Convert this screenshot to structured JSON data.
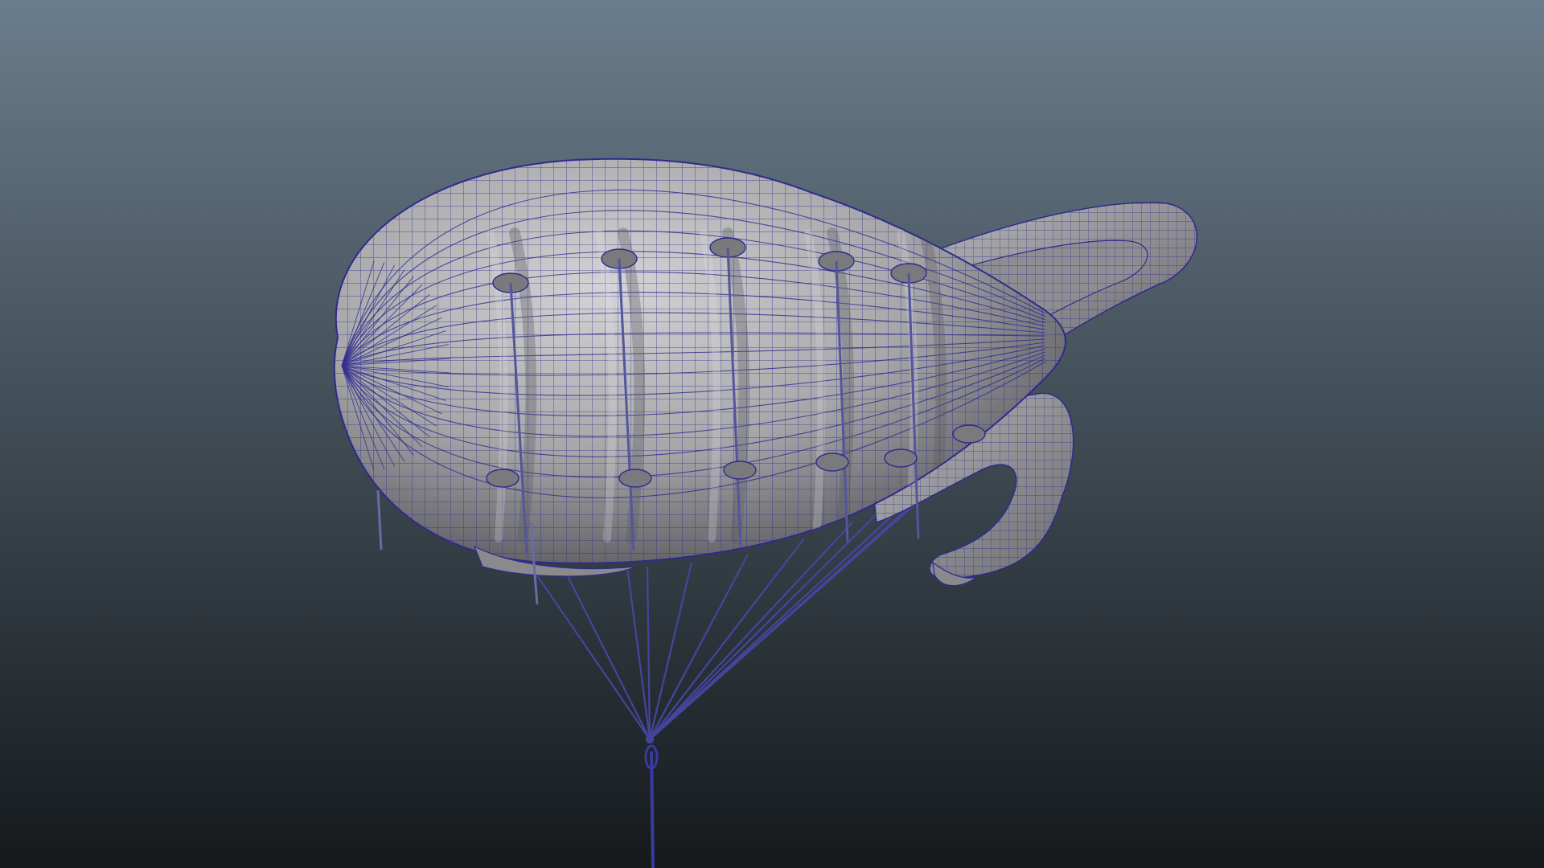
{
  "viewport": {
    "background_top": "#6a7d8c",
    "background_bottom": "#15191c"
  },
  "model": {
    "shaded_color": "#a4a4a6",
    "wireframe_color": "#2f2a8e",
    "highlight_color": "#d2d2d4",
    "shadow_color": "#505054"
  },
  "icons": {
    "airship": "barrage-balloon-mesh",
    "rig": "rigging-lines"
  }
}
